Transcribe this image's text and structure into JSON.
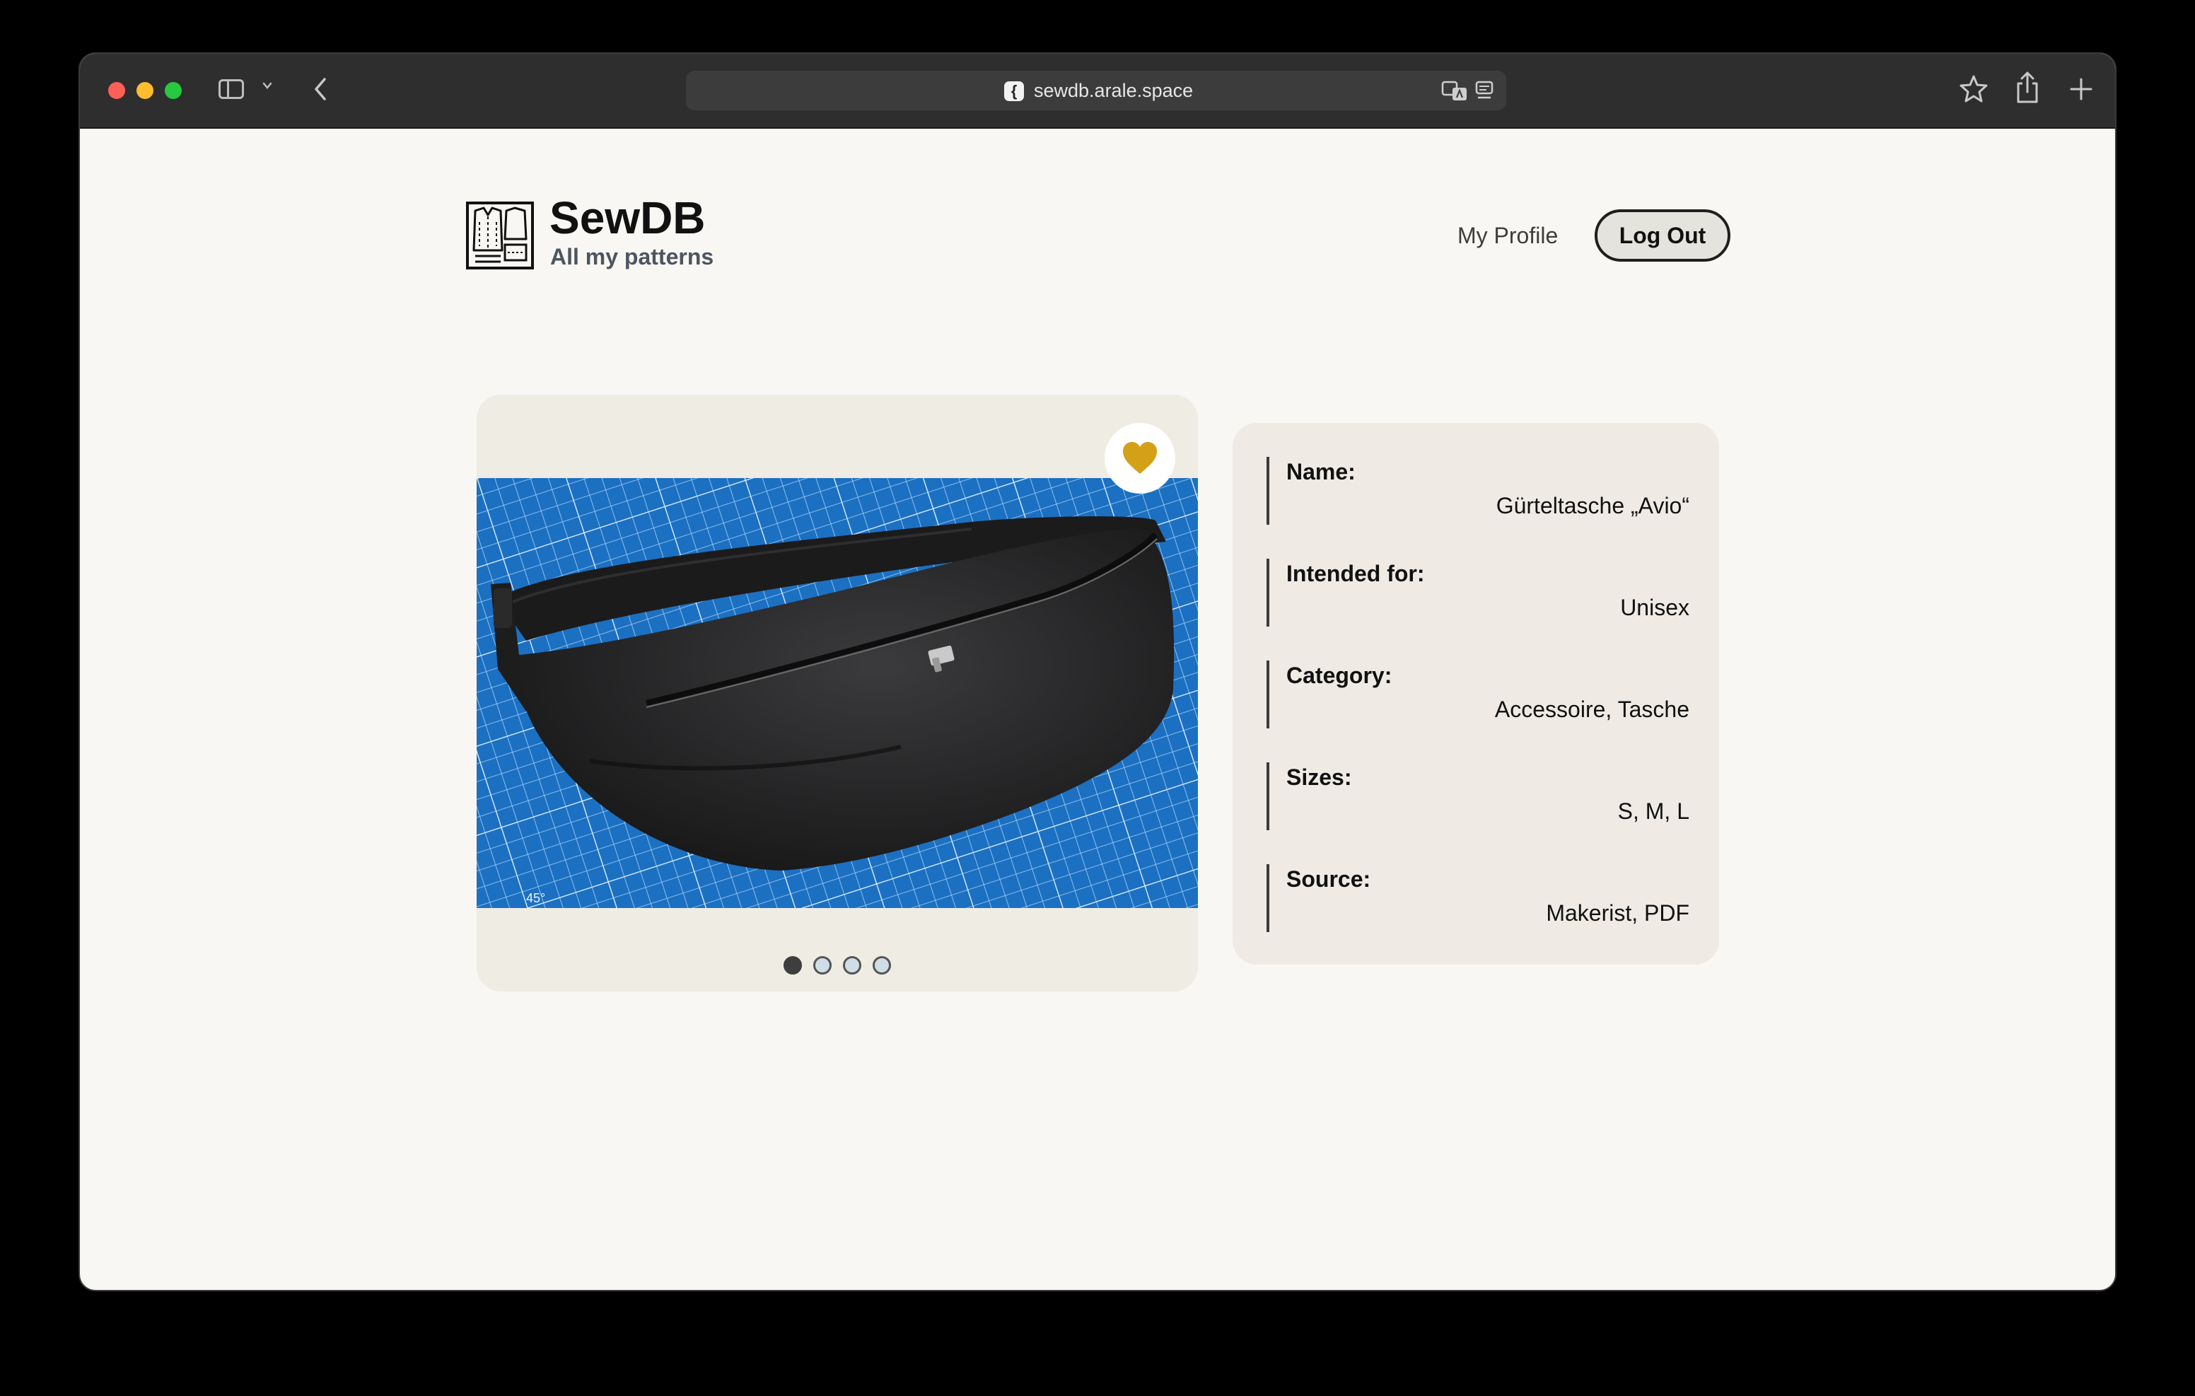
{
  "browser": {
    "url": "sewdb.arale.space",
    "site_icon_glyph": "{"
  },
  "header": {
    "title": "SewDB",
    "subtitle": "All my patterns",
    "nav": {
      "profile": "My Profile",
      "logout": "Log Out"
    }
  },
  "gallery": {
    "favorite": true,
    "favorite_color": "#d4a017",
    "slide_count": 4,
    "active_slide": 1
  },
  "details": {
    "fields": [
      {
        "label": "Name:",
        "value": "Gürteltasche „Avio“"
      },
      {
        "label": "Intended for:",
        "value": "Unisex"
      },
      {
        "label": "Category:",
        "value": "Accessoire, Tasche"
      },
      {
        "label": "Sizes:",
        "value": "S, M, L"
      },
      {
        "label": "Source:",
        "value": "Makerist, PDF"
      }
    ]
  },
  "colors": {
    "page_bg": "#f8f7f3",
    "card_bg": "#efece4",
    "mat_blue": "#1a6fc0"
  }
}
